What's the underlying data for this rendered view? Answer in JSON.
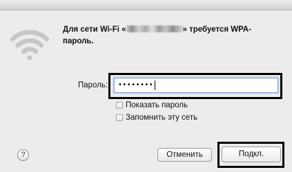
{
  "dialog": {
    "message_prefix": "Для сети Wi-Fi «",
    "message_suffix": "» требуется WPA-пароль.",
    "password_label": "Пароль:",
    "password_value": "••••••••",
    "show_password_label": "Показать пароль",
    "remember_network_label": "Запомнить эту сеть",
    "help_glyph": "?",
    "cancel_label": "Отменить",
    "connect_label": "Подкл."
  },
  "icons": {
    "wifi": "wifi-icon",
    "help": "help-icon"
  },
  "colors": {
    "background": "#ececec",
    "highlight": "#000000",
    "focus_ring": "#a9c3ea",
    "wifi_icon": "#c4c4c4"
  }
}
